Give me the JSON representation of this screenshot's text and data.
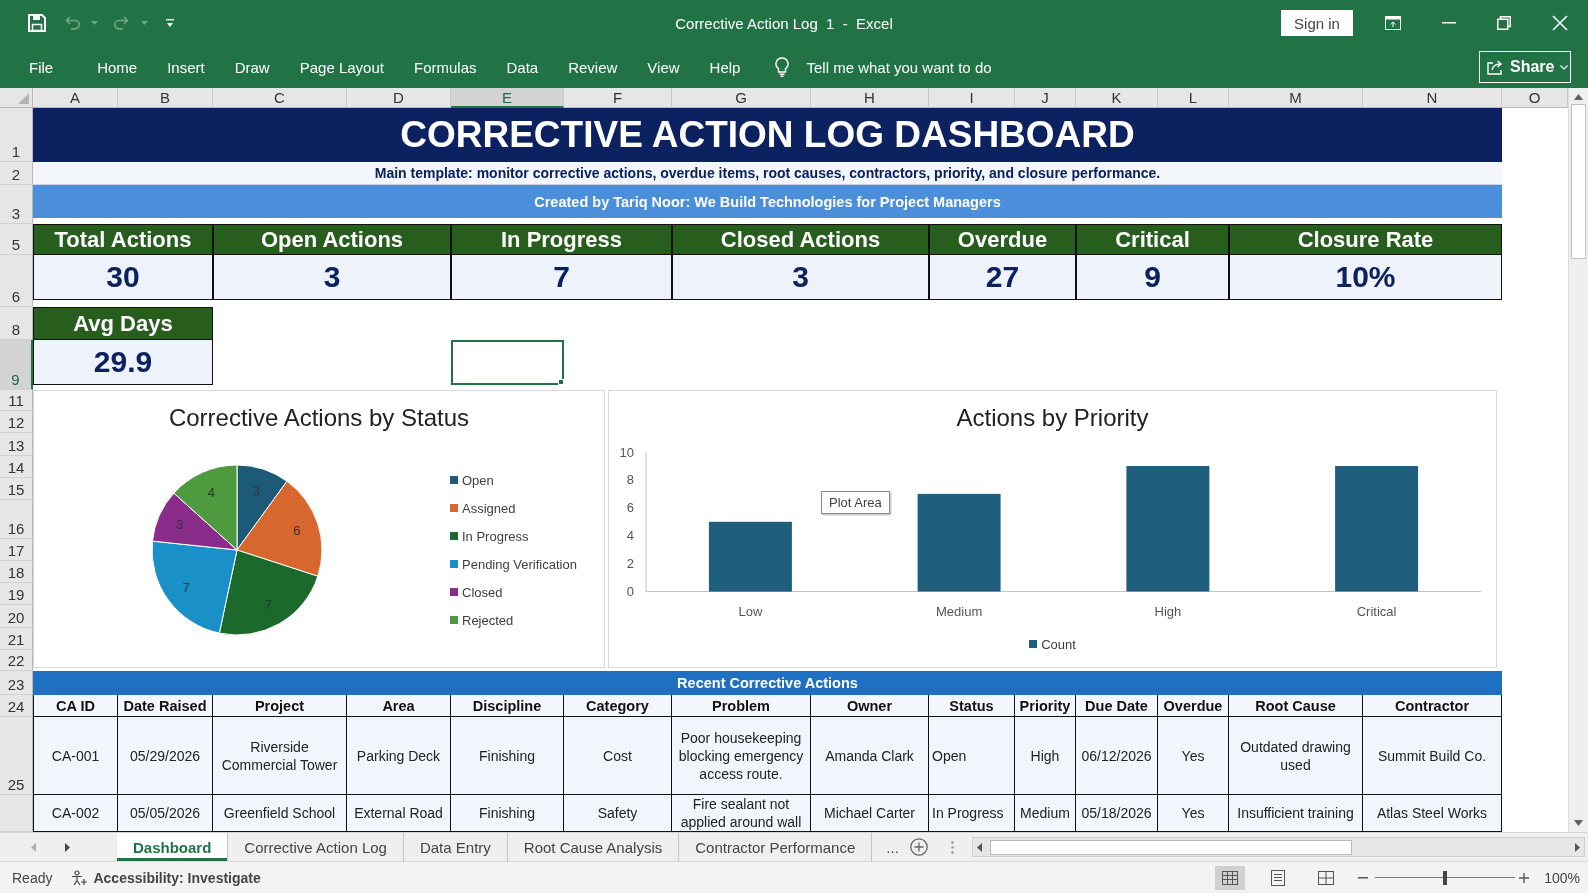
{
  "title_bar": {
    "title": "Corrective Action Log  1  -  Excel",
    "sign_in": "Sign in"
  },
  "quick_access": {
    "undo": {
      "disabled": true
    },
    "redo": {
      "disabled": true
    }
  },
  "ribbon": {
    "tabs": [
      {
        "label": "File",
        "selected": false
      },
      {
        "label": "Home",
        "selected": false
      },
      {
        "label": "Insert",
        "selected": false
      },
      {
        "label": "Draw",
        "selected": false
      },
      {
        "label": "Page Layout",
        "selected": false
      },
      {
        "label": "Formulas",
        "selected": false
      },
      {
        "label": "Data",
        "selected": false
      },
      {
        "label": "Review",
        "selected": false
      },
      {
        "label": "View",
        "selected": false
      },
      {
        "label": "Help",
        "selected": false
      }
    ],
    "tell_me": {
      "placeholder": "Tell me what you want to do"
    },
    "share": "Share"
  },
  "sheet": {
    "columns": [
      {
        "label": "A",
        "selected": false
      },
      {
        "label": "B",
        "selected": false
      },
      {
        "label": "C",
        "selected": false
      },
      {
        "label": "D",
        "selected": false
      },
      {
        "label": "E",
        "selected": true
      },
      {
        "label": "F",
        "selected": false
      },
      {
        "label": "G",
        "selected": false
      },
      {
        "label": "H",
        "selected": false
      },
      {
        "label": "I",
        "selected": false
      },
      {
        "label": "J",
        "selected": false
      },
      {
        "label": "K",
        "selected": false
      },
      {
        "label": "L",
        "selected": false
      },
      {
        "label": "M",
        "selected": false
      },
      {
        "label": "N",
        "selected": false
      },
      {
        "label": "O",
        "selected": false
      }
    ],
    "row_numbers": [
      {
        "label": "1",
        "selected": false
      },
      {
        "label": "2",
        "selected": false
      },
      {
        "label": "3",
        "selected": false
      },
      {
        "label": "5",
        "selected": false
      },
      {
        "label": "6",
        "selected": false
      },
      {
        "label": "8",
        "selected": false
      },
      {
        "label": "9",
        "selected": true
      },
      {
        "label": "11",
        "selected": false
      },
      {
        "label": "12",
        "selected": false
      },
      {
        "label": "13",
        "selected": false
      },
      {
        "label": "14",
        "selected": false
      },
      {
        "label": "15",
        "selected": false
      },
      {
        "label": "16",
        "selected": false
      },
      {
        "label": "17",
        "selected": false
      },
      {
        "label": "18",
        "selected": false
      },
      {
        "label": "19",
        "selected": false
      },
      {
        "label": "20",
        "selected": false
      },
      {
        "label": "21",
        "selected": false
      },
      {
        "label": "22",
        "selected": false
      },
      {
        "label": "23",
        "selected": false
      },
      {
        "label": "24",
        "selected": false
      },
      {
        "label": "25",
        "selected": false
      }
    ]
  },
  "dashboard": {
    "title": "CORRECTIVE ACTION LOG DASHBOARD",
    "subtitle": "Main template: monitor corrective actions, overdue items, root causes, contractors, priority, and closure performance.",
    "credit": "Created by Tariq Noor: We Build Technologies for Project Managers",
    "kpis": [
      {
        "label": "Total Actions",
        "value": "30"
      },
      {
        "label": "Open Actions",
        "value": "3"
      },
      {
        "label": "In Progress",
        "value": "7"
      },
      {
        "label": "Closed Actions",
        "value": "3"
      },
      {
        "label": "Overdue",
        "value": "27"
      },
      {
        "label": "Critical",
        "value": "9"
      },
      {
        "label": "Closure Rate",
        "value": "10%"
      }
    ],
    "avg_days": {
      "label": "Avg Days",
      "value": "29.9"
    }
  },
  "status_chart": {
    "chart_data": {
      "type": "pie",
      "title": "Corrective Actions by Status",
      "categories": [
        "Open",
        "Assigned",
        "In Progress",
        "Pending Verification",
        "Closed",
        "Rejected"
      ],
      "values": [
        3,
        6,
        7,
        7,
        3,
        4
      ],
      "colors": [
        "#1d5a78",
        "#d8672f",
        "#1b6a2b",
        "#1990c8",
        "#8a2c8a",
        "#4d9a3f"
      ],
      "data_labels": true,
      "legend": "right"
    }
  },
  "priority_chart": {
    "tooltip": "Plot Area",
    "chart_data": {
      "type": "bar",
      "title": "Actions by Priority",
      "categories": [
        "Low",
        "Medium",
        "High",
        "Critical"
      ],
      "series": [
        {
          "name": "Count",
          "color": "#1f5f7e",
          "values": [
            5,
            7,
            9,
            9
          ]
        }
      ],
      "ylim": [
        0,
        10
      ],
      "yticks": [
        0,
        2,
        4,
        6,
        8,
        10
      ],
      "legend": "bottom"
    }
  },
  "recent_actions": {
    "title": "Recent Corrective Actions",
    "columns": [
      "CA ID",
      "Date Raised",
      "Project",
      "Area",
      "Discipline",
      "Category",
      "Problem",
      "Owner",
      "Status",
      "Priority",
      "Due Date",
      "Overdue",
      "Root Cause",
      "Contractor"
    ],
    "rows": [
      [
        "CA-001",
        "05/29/2026",
        "Riverside Commercial Tower",
        "Parking Deck",
        "Finishing",
        "Cost",
        "Poor housekeeping blocking emergency access route.",
        "Amanda Clark",
        "Open",
        "High",
        "06/12/2026",
        "Yes",
        "Outdated drawing used",
        "Summit Build Co."
      ],
      [
        "CA-002",
        "05/05/2026",
        "Greenfield School",
        "External Road",
        "Finishing",
        "Safety",
        "Fire sealant not applied around wall",
        "Michael Carter",
        "In Progress",
        "Medium",
        "05/18/2026",
        "Yes",
        "Insufficient training",
        "Atlas Steel Works"
      ]
    ]
  },
  "sheet_tabs": {
    "tabs": [
      {
        "label": "Dashboard",
        "selected": true
      },
      {
        "label": "Corrective Action Log",
        "selected": false
      },
      {
        "label": "Data Entry",
        "selected": false
      },
      {
        "label": "Root Cause Analysis",
        "selected": false
      },
      {
        "label": "Contractor Performance",
        "selected": false
      }
    ],
    "more": "..."
  },
  "status_bar": {
    "status": "Ready",
    "accessibility": "Accessibility: Investigate",
    "views": [
      {
        "kind": "normal",
        "selected": true
      },
      {
        "kind": "page_layout",
        "selected": false
      },
      {
        "kind": "page_break",
        "selected": false
      }
    ],
    "zoom": {
      "level": 0.5,
      "reading": "100%"
    }
  }
}
